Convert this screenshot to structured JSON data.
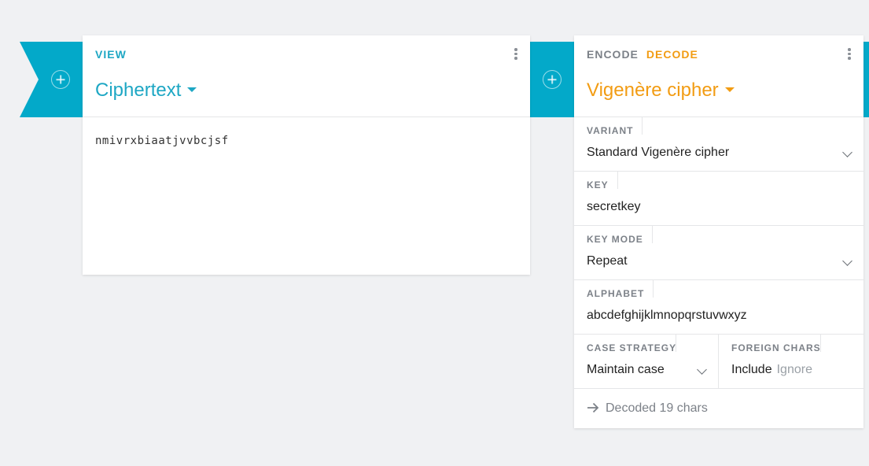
{
  "view_card": {
    "tab_view": "VIEW",
    "title": "Ciphertext",
    "content": "nmivrxbiaatjvvbcjsf"
  },
  "cipher_card": {
    "tab_encode": "ENCODE",
    "tab_decode": "DECODE",
    "title": "Vigenère cipher",
    "fields": {
      "variant": {
        "label": "VARIANT",
        "value": "Standard Vigenère cipher"
      },
      "key": {
        "label": "KEY",
        "value": "secretkey"
      },
      "key_mode": {
        "label": "KEY MODE",
        "value": "Repeat"
      },
      "alphabet": {
        "label": "ALPHABET",
        "value": "abcdefghijklmnopqrstuvwxyz"
      },
      "case_strategy": {
        "label": "CASE STRATEGY",
        "value": "Maintain case"
      },
      "foreign_chars": {
        "label": "FOREIGN CHARS",
        "option_selected": "Include",
        "option_other": "Ignore"
      }
    },
    "status": "Decoded 19 chars"
  },
  "colors": {
    "accent_cyan": "#1ea7c4",
    "accent_orange": "#f29c13",
    "ribbon": "#03a9c9",
    "background": "#f0f1f3"
  },
  "icons": [
    "add-circle-icon",
    "more-vert-icon",
    "caret-down-icon",
    "chevron-down-icon",
    "arrow-right-icon"
  ]
}
